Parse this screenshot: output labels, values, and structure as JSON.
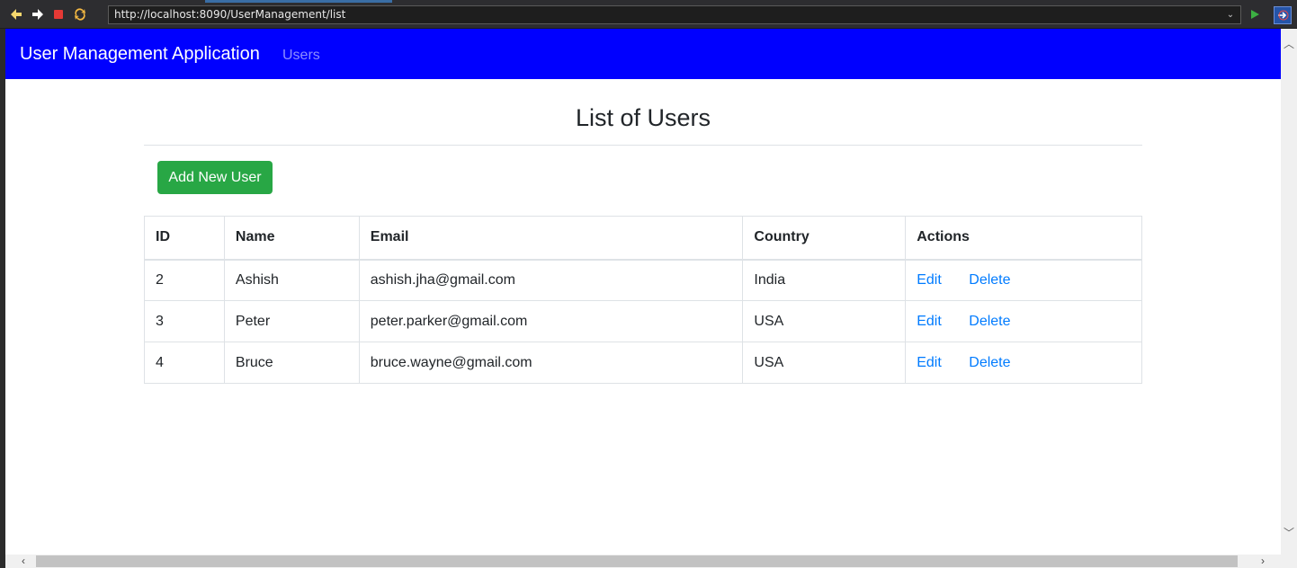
{
  "browser": {
    "url": "http://localhost:8090/UserManagement/list"
  },
  "navbar": {
    "brand": "User Management Application",
    "links": [
      "Users"
    ],
    "bg_color": "#0000ff"
  },
  "main": {
    "title": "List of Users",
    "add_button_label": "Add New User",
    "table": {
      "headers": [
        "ID",
        "Name",
        "Email",
        "Country",
        "Actions"
      ],
      "rows": [
        {
          "id": "2",
          "name": "Ashish",
          "email": "ashish.jha@gmail.com",
          "country": "India",
          "edit": "Edit",
          "delete": "Delete"
        },
        {
          "id": "3",
          "name": "Peter",
          "email": "peter.parker@gmail.com",
          "country": "USA",
          "edit": "Edit",
          "delete": "Delete"
        },
        {
          "id": "4",
          "name": "Bruce",
          "email": "bruce.wayne@gmail.com",
          "country": "USA",
          "edit": "Edit",
          "delete": "Delete"
        }
      ]
    }
  },
  "colors": {
    "success": "#28a745",
    "link": "#007bff"
  }
}
